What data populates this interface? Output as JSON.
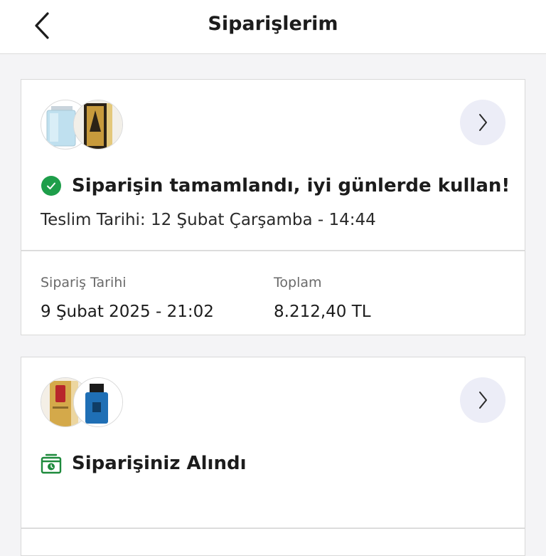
{
  "header": {
    "title": "Siparişlerim",
    "back_icon": "chevron-left-icon"
  },
  "orders": [
    {
      "products": [
        {
          "name": "light-blue-perfume-bottle",
          "icon": "perfume-bottle-icon"
        },
        {
          "name": "gold-perfume-bottle",
          "icon": "perfume-bottle-icon"
        }
      ],
      "status_icon": "check-circle-icon",
      "status_color": "#1e9e4a",
      "status_text": "Siparişin tamamlandı, iyi günlerde kullan!",
      "delivery_text": "Teslim Tarihi: 12 Şubat Çarşamba - 14:44",
      "order_date_label": "Sipariş Tarihi",
      "order_date_value": "9 Şubat 2025 - 21:02",
      "total_label": "Toplam",
      "total_value": "8.212,40 TL"
    },
    {
      "products": [
        {
          "name": "gold-red-perfume-bottle",
          "icon": "perfume-bottle-icon"
        },
        {
          "name": "blue-perfume-bottle",
          "icon": "perfume-bottle-icon"
        }
      ],
      "status_icon": "package-clock-icon",
      "status_color": "#1e8a3c",
      "status_text": "Siparişiniz Alındı"
    }
  ]
}
